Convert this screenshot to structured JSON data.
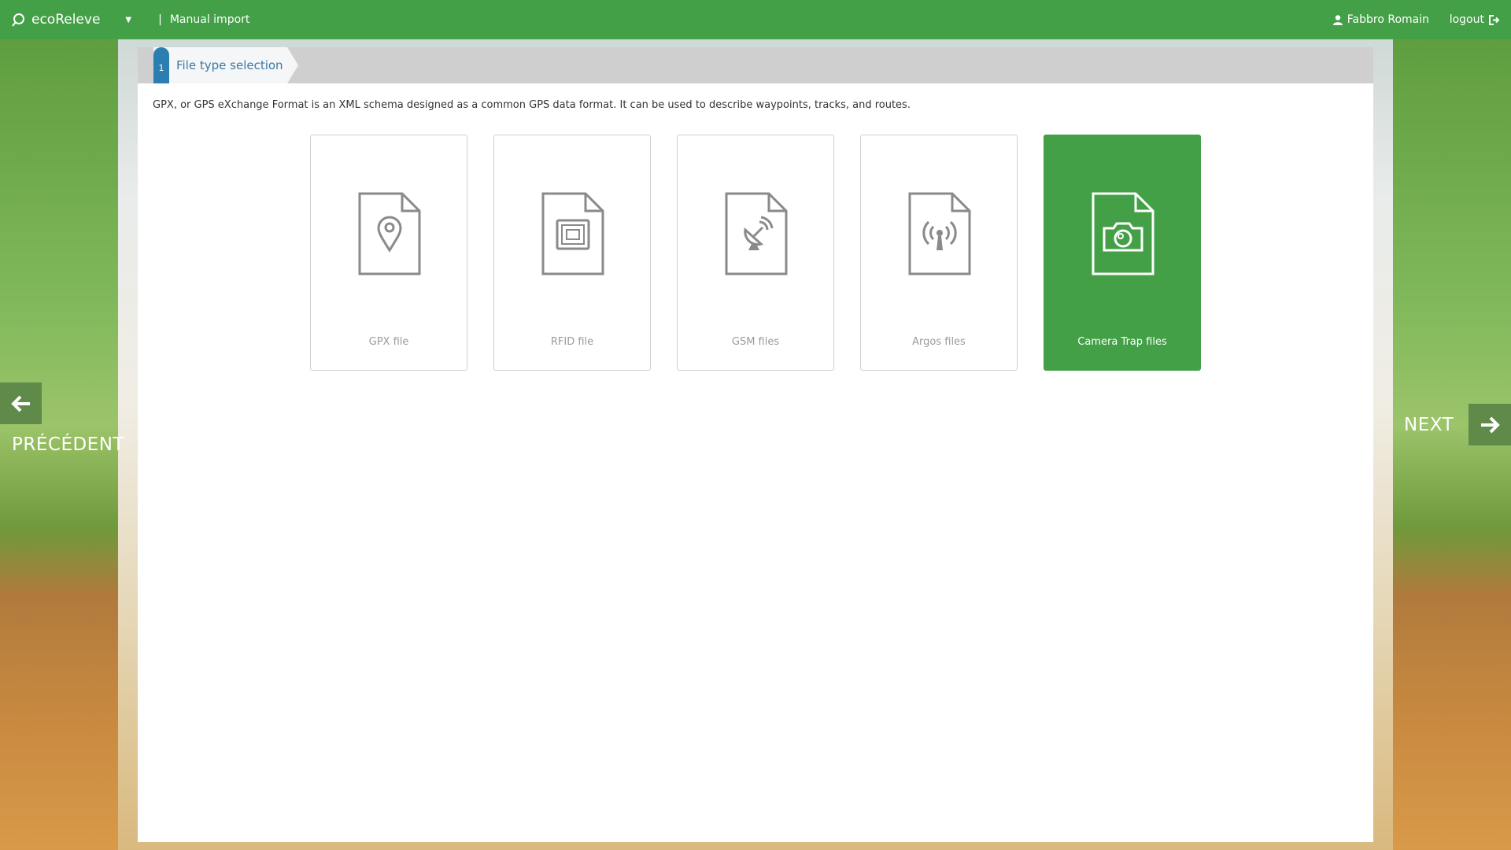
{
  "header": {
    "app_name": "ecoReleve",
    "breadcrumb": "Manual import",
    "user_name": "Fabbro Romain",
    "logout_label": "logout"
  },
  "stepper": {
    "step_number": "1",
    "step_label": "File type selection"
  },
  "description": "GPX, or GPS eXchange Format is an XML schema designed as a common GPS data format. It can be used to describe waypoints, tracks, and routes.",
  "file_types": [
    {
      "label": "GPX file",
      "icon": "gpx-file-icon",
      "selected": false
    },
    {
      "label": "RFID file",
      "icon": "rfid-file-icon",
      "selected": false
    },
    {
      "label": "GSM files",
      "icon": "gsm-file-icon",
      "selected": false
    },
    {
      "label": "Argos files",
      "icon": "argos-file-icon",
      "selected": false
    },
    {
      "label": "Camera Trap files",
      "icon": "camera-trap-file-icon",
      "selected": true
    }
  ],
  "navigation": {
    "prev_label": "PRÉCÉDENT",
    "next_label": "NEXT"
  },
  "colors": {
    "brand_green": "#43a047",
    "step_blue": "#2a7fb0"
  }
}
